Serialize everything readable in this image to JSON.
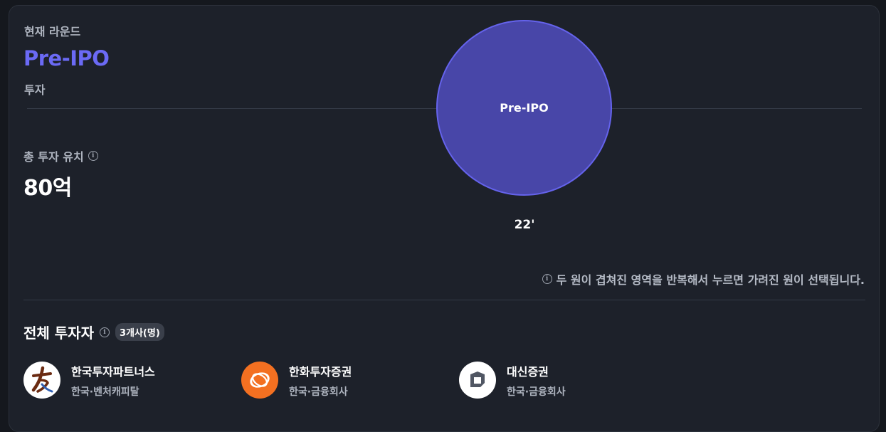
{
  "current_round": {
    "label": "현재 라운드",
    "name": "Pre-IPO",
    "type": "투자"
  },
  "total_investment": {
    "label": "총 투자 유치",
    "info_icon": "info-icon",
    "value": "80억"
  },
  "round_circle": {
    "label": "Pre-IPO",
    "color": "#4846a8",
    "border_color": "#6563ec"
  },
  "year_label": "22'",
  "hint": "두 원이 겹쳐진 영역을 반복해서 누르면 가려진 원이 선택됩니다.",
  "investors": {
    "title": "전체 투자자",
    "count_badge": "3개사(명)",
    "items": [
      {
        "name": "한국투자파트너스",
        "meta": "한국·벤처캐피탈",
        "logo": "korea-investment-partners-logo"
      },
      {
        "name": "한화투자증권",
        "meta": "한국·금융회사",
        "logo": "hanwha-logo"
      },
      {
        "name": "대신증권",
        "meta": "한국·금융회사",
        "logo": "daishin-logo"
      }
    ]
  },
  "colors": {
    "accent": "#6b6af5",
    "background": "#1d212a",
    "hanwha_orange": "#f37021"
  }
}
